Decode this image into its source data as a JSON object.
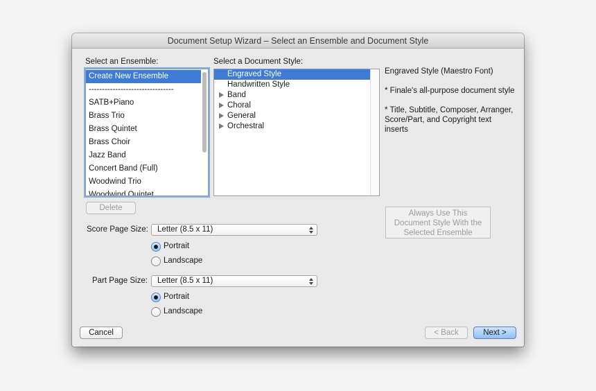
{
  "window": {
    "title": "Document Setup Wizard – Select an Ensemble and Document Style"
  },
  "ensemble": {
    "label": "Select an Ensemble:",
    "items": [
      "Create New Ensemble",
      "--------------------------------",
      "SATB+Piano",
      "Brass Trio",
      "Brass Quintet",
      "Brass Choir",
      "Jazz Band",
      "Concert Band (Full)",
      "Woodwind Trio",
      "Woodwind Quintet"
    ],
    "selected": "Create New Ensemble",
    "delete_label": "Delete"
  },
  "style": {
    "label": "Select a Document Style:",
    "items": [
      {
        "label": "Engraved Style"
      },
      {
        "label": "Handwritten Style"
      },
      {
        "label": "Band",
        "expandable": true
      },
      {
        "label": "Choral",
        "expandable": true
      },
      {
        "label": "General",
        "expandable": true
      },
      {
        "label": "Orchestral",
        "expandable": true
      }
    ],
    "selected": "Engraved Style"
  },
  "description": {
    "title": "Engraved Style (Maestro Font)",
    "line1": "* Finale's all-purpose document style",
    "line2": "* Title, Subtitle, Composer, Arranger, Score/Part, and Copyright text inserts"
  },
  "always_use": {
    "line1": "Always Use This",
    "line2": "Document Style With the",
    "line3": "Selected Ensemble"
  },
  "score_page": {
    "label": "Score Page Size:",
    "value": "Letter (8.5 x 11)",
    "portrait": "Portrait",
    "landscape": "Landscape",
    "orientation": "Portrait"
  },
  "part_page": {
    "label": "Part Page Size:",
    "value": "Letter (8.5 x 11)",
    "portrait": "Portrait",
    "landscape": "Landscape",
    "orientation": "Portrait"
  },
  "buttons": {
    "cancel": "Cancel",
    "back": "< Back",
    "next": "Next >"
  },
  "colors": {
    "selection": "#3d7bd6",
    "default_button": "#8fc1f4",
    "focus_ring": "#7faee8"
  }
}
